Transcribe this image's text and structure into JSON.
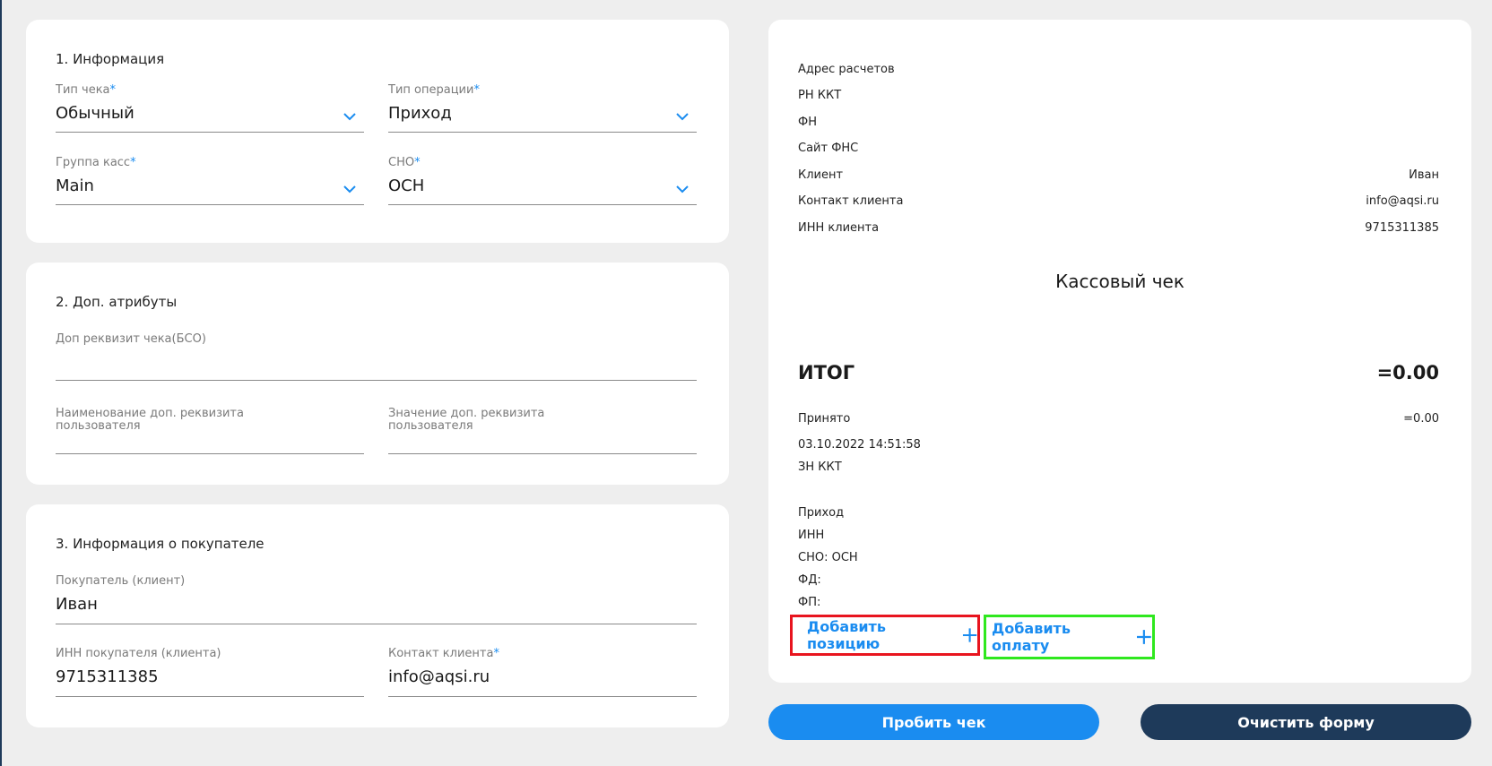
{
  "section1": {
    "title": "1. Информация",
    "check_type": {
      "label": "Тип чека",
      "value": "Обычный"
    },
    "operation_type": {
      "label": "Тип операции",
      "value": "Приход"
    },
    "cash_group": {
      "label": "Группа касс",
      "value": "Main"
    },
    "sno": {
      "label": "СНО",
      "value": "ОСН"
    }
  },
  "section2": {
    "title": "2. Доп. атрибуты",
    "bso": {
      "label": "Доп реквизит чека(БСО)",
      "value": ""
    },
    "user_attr_name": {
      "label": "Наименование доп. реквизита пользователя",
      "value": ""
    },
    "user_attr_value": {
      "label": "Значение доп. реквизита пользователя",
      "value": ""
    }
  },
  "section3": {
    "title": "3. Информация о покупателе",
    "buyer": {
      "label": "Покупатель (клиент)",
      "value": "Иван"
    },
    "buyer_inn": {
      "label": "ИНН покупателя (клиента)",
      "value": "9715311385"
    },
    "contact": {
      "label": "Контакт клиента",
      "value": "info@aqsi.ru"
    }
  },
  "receipt": {
    "rows_top": [
      {
        "label": "Адрес расчетов",
        "value": ""
      },
      {
        "label": "РН ККТ",
        "value": ""
      },
      {
        "label": "ФН",
        "value": ""
      },
      {
        "label": "Сайт ФНС",
        "value": ""
      },
      {
        "label": "Клиент",
        "value": "Иван"
      },
      {
        "label": "Контакт клиента",
        "value": "info@aqsi.ru"
      },
      {
        "label": "ИНН клиента",
        "value": "9715311385"
      }
    ],
    "title": "Кассовый чек",
    "total_label": "ИТОГ",
    "total_value": "=0.00",
    "accepted_label": "Принято",
    "accepted_value": "=0.00",
    "datetime": "03.10.2022 14:51:58",
    "zn_kkt": "ЗН ККТ",
    "operation": "Приход",
    "inn": "ИНН",
    "sno": "СНО: ОСН",
    "fd": "ФД:",
    "fp": "ФП:",
    "add_position": "Добавить позицию",
    "add_payment": "Добавить оплату"
  },
  "actions": {
    "print_check": "Пробить чек",
    "clear_form": "Очистить форму"
  },
  "colors": {
    "accent": "#1a8cf0",
    "dark_button": "#1e3a5a",
    "red_highlight": "#e8141e",
    "green_highlight": "#2fe81e"
  }
}
